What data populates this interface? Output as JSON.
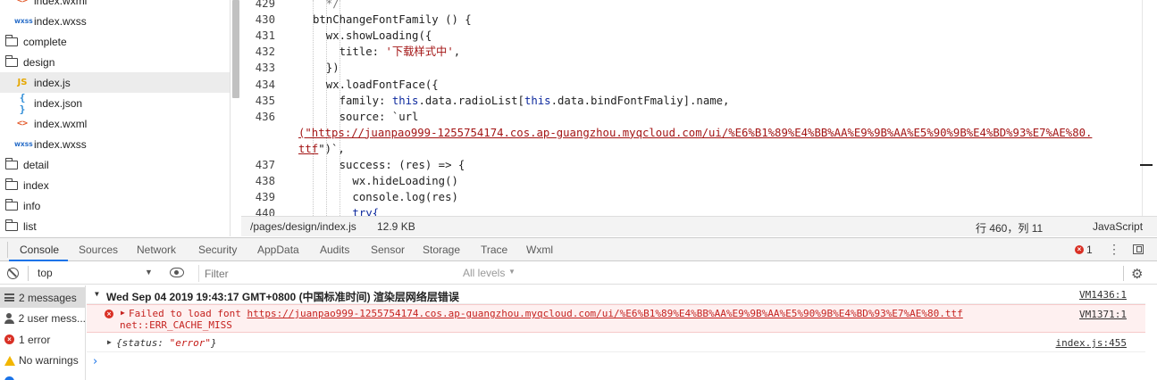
{
  "file_tree": {
    "items": [
      {
        "name": "index.wxml",
        "type": "wxml",
        "icon": "<>",
        "indent": 1
      },
      {
        "name": "index.wxss",
        "type": "wxss",
        "icon": "wxss",
        "indent": 1
      },
      {
        "name": "complete",
        "type": "folder",
        "indent": 0
      },
      {
        "name": "design",
        "type": "folder-open",
        "indent": 0
      },
      {
        "name": "index.js",
        "type": "js",
        "icon": "JS",
        "indent": 1,
        "selected": true
      },
      {
        "name": "index.json",
        "type": "json",
        "icon": "{}",
        "indent": 1
      },
      {
        "name": "index.wxml",
        "type": "wxml",
        "icon": "<>",
        "indent": 1
      },
      {
        "name": "index.wxss",
        "type": "wxss",
        "icon": "wxss",
        "indent": 1
      },
      {
        "name": "detail",
        "type": "folder",
        "indent": 0
      },
      {
        "name": "index",
        "type": "folder",
        "indent": 0
      },
      {
        "name": "info",
        "type": "folder",
        "indent": 0
      },
      {
        "name": "list",
        "type": "folder",
        "indent": 0
      }
    ]
  },
  "editor": {
    "lines": [
      {
        "n": "429",
        "segs": [
          {
            "t": "  */",
            "c": "cmt"
          }
        ]
      },
      {
        "n": "430",
        "segs": [
          {
            "t": "btnChangeFontFamily () {",
            "c": ""
          }
        ]
      },
      {
        "n": "431",
        "segs": [
          {
            "t": "  wx.showLoading({",
            "c": ""
          }
        ]
      },
      {
        "n": "432",
        "segs": [
          {
            "t": "    title: ",
            "c": ""
          },
          {
            "t": "'下载样式中'",
            "c": "str"
          },
          {
            "t": ",",
            "c": ""
          }
        ]
      },
      {
        "n": "433",
        "segs": [
          {
            "t": "  })",
            "c": ""
          }
        ]
      },
      {
        "n": "434",
        "segs": [
          {
            "t": "  wx.loadFontFace({",
            "c": ""
          }
        ]
      },
      {
        "n": "435",
        "segs": [
          {
            "t": "    family: ",
            "c": ""
          },
          {
            "t": "this",
            "c": "kw"
          },
          {
            "t": ".data.radioList[",
            "c": ""
          },
          {
            "t": "this",
            "c": "kw"
          },
          {
            "t": ".data.bindFontFmaliy].name,",
            "c": ""
          }
        ]
      },
      {
        "n": "436",
        "segs": [
          {
            "t": "    source: `url",
            "c": ""
          }
        ]
      },
      {
        "n": "",
        "wrap": true,
        "segs": [
          {
            "t": "(\"https://juanpao999-1255754174.cos.ap-guangzhou.myqcloud.com/ui/%E6%B1%89%E4%BB%AA%E9%9B%AA%E5%90%9B%E4%BD%93%E7%AE%80.",
            "c": "tpl"
          }
        ]
      },
      {
        "n": "",
        "wrap": true,
        "segs": [
          {
            "t": "ttf",
            "c": "tpl"
          },
          {
            "t": "\")`,",
            "c": ""
          }
        ]
      },
      {
        "n": "437",
        "segs": [
          {
            "t": "    success: (res) => {",
            "c": ""
          }
        ]
      },
      {
        "n": "438",
        "segs": [
          {
            "t": "      wx.hideLoading()",
            "c": ""
          }
        ]
      },
      {
        "n": "439",
        "segs": [
          {
            "t": "      console.log(res)",
            "c": ""
          }
        ]
      },
      {
        "n": "440",
        "segs": [
          {
            "t": "      try{",
            "c": "kw"
          }
        ]
      }
    ]
  },
  "status_bar": {
    "path": "/pages/design/index.js",
    "size": "12.9 KB",
    "cursor": "行 460，列 11",
    "language": "JavaScript"
  },
  "devtools_tabs": [
    "Console",
    "Sources",
    "Network",
    "Security",
    "AppData",
    "Audits",
    "Sensor",
    "Storage",
    "Trace",
    "Wxml"
  ],
  "devtools": {
    "active_tab": "Console",
    "error_count": "1",
    "accent_color": "#1a73e8",
    "error_color": "#d93025"
  },
  "filter_bar": {
    "context": "top",
    "filter_placeholder": "Filter",
    "levels": "All levels"
  },
  "console_sidebar": [
    {
      "label": "2 messages",
      "icon": "list-icon",
      "selected": true
    },
    {
      "label": "2 user mess...",
      "icon": "user-icon"
    },
    {
      "label": "1 error",
      "icon": "error-icon"
    },
    {
      "label": "No warnings",
      "icon": "warning-icon"
    },
    {
      "label": "",
      "icon": "info-icon"
    }
  ],
  "console": {
    "group_header": "Wed Sep 04 2019 19:43:17 GMT+0800 (中国标准时间) 渲染层网络层错误",
    "group_source": "VM1436:1",
    "error_prefix": "Failed to load font ",
    "error_url": "https://juanpao999-1255754174.cos.ap-guangzhou.myqcloud.com/ui/%E6%B1%89%E4%BB%AA%E9%9B%AA%E5%90%9B%E4%BD%93%E7%AE%80.ttf",
    "error_detail": "net::ERR_CACHE_MISS",
    "error_source": "VM1371:1",
    "object_key": "status",
    "object_value": "\"error\"",
    "object_source": "index.js:455"
  }
}
